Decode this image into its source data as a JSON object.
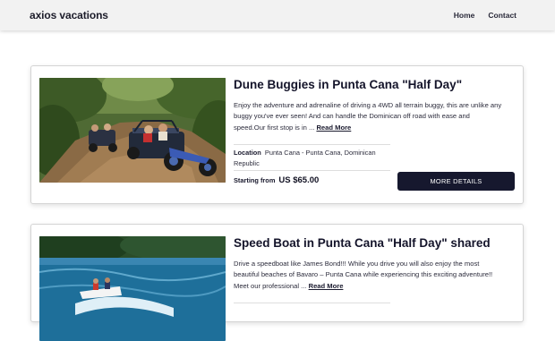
{
  "header": {
    "brand": "axios vacations",
    "nav": [
      {
        "label": "Home"
      },
      {
        "label": "Contact"
      }
    ]
  },
  "tours": [
    {
      "title": "Dune Buggies in Punta Cana \"Half Day\"",
      "description": "Enjoy the adventure and adrenaline of driving a 4WD all terrain buggy, this are unlike any buggy you've ever seen! And can handle the Dominican off road with ease and speed.Our first stop is in ...",
      "read_more": "Read More",
      "location_label": "Location",
      "location_value": "Punta Cana -  Punta Cana, Dominican Republic",
      "price_label": "Starting from",
      "price_value": "US $65.00",
      "cta": "MORE DETAILS"
    },
    {
      "title": "Speed Boat in Punta Cana \"Half Day\" shared",
      "description": "Drive a speedboat like James Bond!!! While you drive you will also enjoy the most beautiful beaches of Bavaro – Punta Cana while experiencing this exciting adventure!! Meet our professional ...",
      "read_more": "Read More"
    }
  ],
  "colors": {
    "header_bg": "#f2f2f2",
    "button_bg": "#16182e",
    "text_dark": "#14142a"
  }
}
